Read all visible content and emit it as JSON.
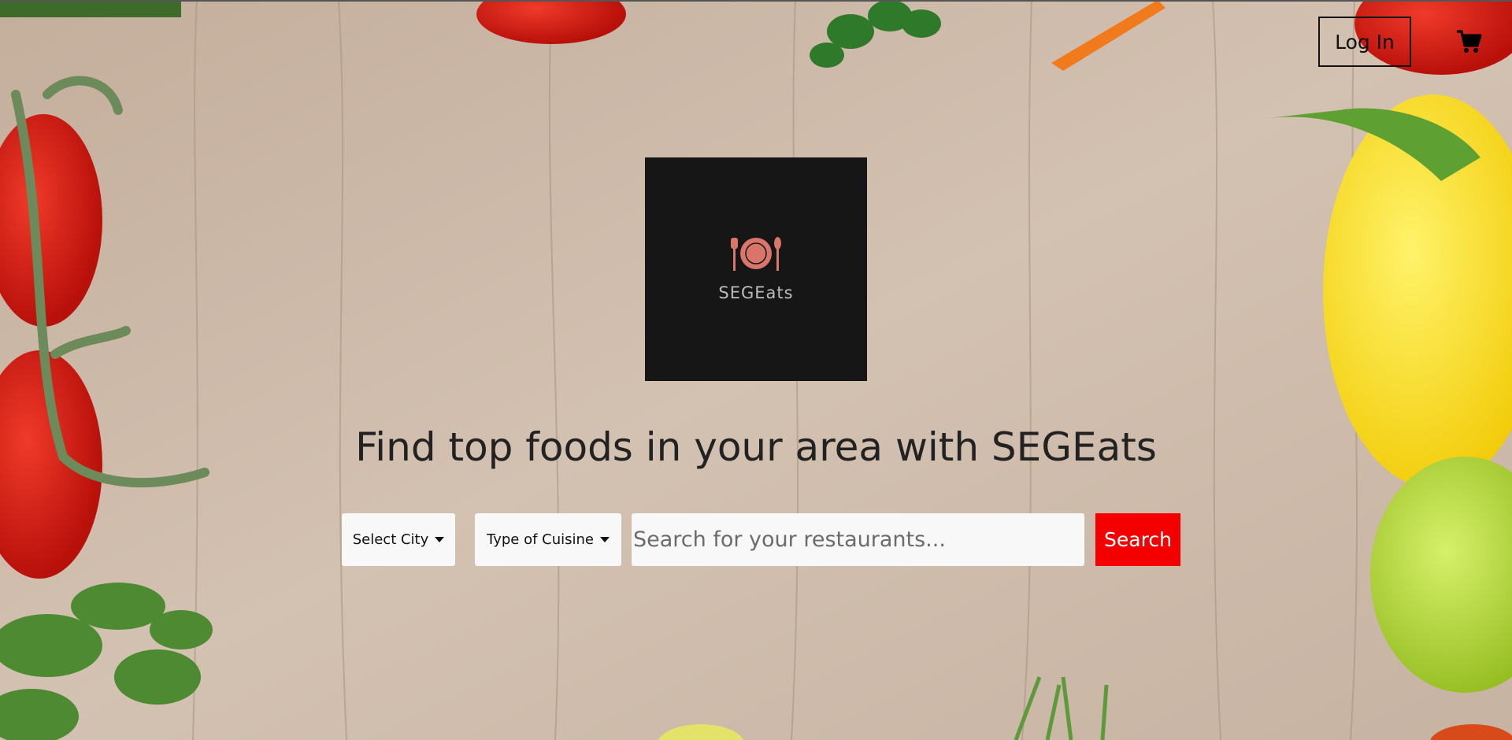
{
  "header": {
    "login_label": "Log In",
    "cart_icon": "shopping-cart-icon"
  },
  "logo": {
    "text": "SEGEats",
    "icon": "plate-fork-knife-icon"
  },
  "hero": {
    "headline": "Find top foods in your area with SEGEats"
  },
  "search": {
    "city_label": "Select City",
    "cuisine_label": "Type of Cuisine",
    "placeholder": "Search for your restaurants...",
    "button_label": "Search"
  },
  "colors": {
    "search_button": "#f40000",
    "logo_background": "#161616",
    "logo_icon": "#d9756a"
  }
}
